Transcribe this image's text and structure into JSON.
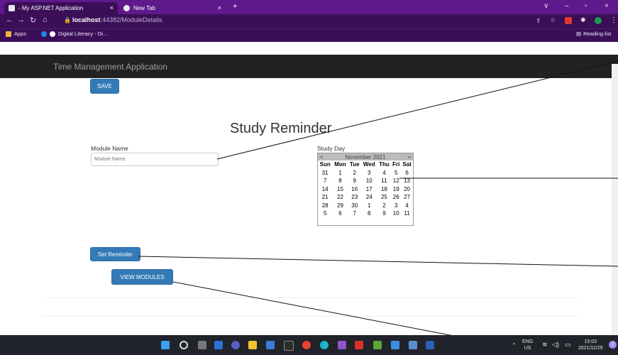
{
  "browser": {
    "tabs": [
      {
        "label": "- My ASP.NET Application",
        "close": "×"
      },
      {
        "label": "New Tab",
        "close": "×"
      }
    ],
    "new_tab": "+",
    "window_controls": [
      "∨",
      "–",
      "▫",
      "×"
    ],
    "url_host": "localhost",
    "url_path": ":44382/ModuleDetails",
    "bookmarks": [
      "Apps",
      "Digital Literacy - Di..."
    ],
    "reading_list": "Reading list"
  },
  "app": {
    "brand": "Time Management Application",
    "save_label": "SAVE",
    "title": "Study Reminder",
    "module_name_label": "Module Name",
    "module_name_placeholder": "Module Name",
    "study_day_label": "Study Day",
    "calendar": {
      "month": "November 2021",
      "prev": "<",
      "next": ">",
      "days": [
        "Sun",
        "Mon",
        "Tue",
        "Wed",
        "Thu",
        "Fri",
        "Sat"
      ],
      "weeks": [
        [
          "31",
          "1",
          "2",
          "3",
          "4",
          "5",
          "6"
        ],
        [
          "7",
          "8",
          "9",
          "10",
          "11",
          "12",
          "13"
        ],
        [
          "14",
          "15",
          "16",
          "17",
          "18",
          "19",
          "20"
        ],
        [
          "21",
          "22",
          "23",
          "24",
          "25",
          "26",
          "27"
        ],
        [
          "28",
          "29",
          "30",
          "1",
          "2",
          "3",
          "4"
        ],
        [
          "5",
          "6",
          "7",
          "8",
          "9",
          "10",
          "11"
        ]
      ]
    },
    "set_reminder_label": "Set Reminder",
    "view_modules_label": "VIEW MODULES"
  },
  "taskbar": {
    "lang": "ENG",
    "lang_sub": "US",
    "time": "15:03",
    "date": "2021/11/29",
    "notif_count": "2"
  }
}
